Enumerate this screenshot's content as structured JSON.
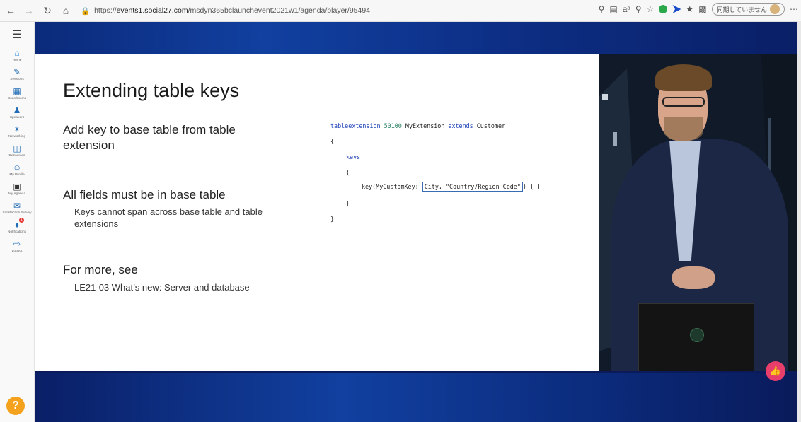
{
  "browser": {
    "url_prefix": "https://",
    "url_domain": "events1.social27.com",
    "url_path": "/msdyn365bclaunchevent2021w1/agenda/player/95494",
    "sync_label": "同期していません"
  },
  "sidebar": {
    "items": [
      {
        "label": "Home",
        "icon": "home-icon"
      },
      {
        "label": "Sessions",
        "icon": "pencil-icon"
      },
      {
        "label": "Boardrooms",
        "icon": "boardroom-icon"
      },
      {
        "label": "Speakers",
        "icon": "speaker-icon"
      },
      {
        "label": "Networking",
        "icon": "networking-icon"
      },
      {
        "label": "Resources",
        "icon": "resources-icon"
      },
      {
        "label": "My Profile",
        "icon": "profile-icon"
      },
      {
        "label": "My Agenda",
        "icon": "agenda-icon"
      },
      {
        "label": "Satisfaction Survey",
        "icon": "survey-icon"
      },
      {
        "label": "Notifications",
        "icon": "bell-icon",
        "badge": "1"
      },
      {
        "label": "Logout",
        "icon": "logout-icon"
      }
    ],
    "help": "?"
  },
  "slide": {
    "title": "Extending table keys",
    "bullet1": "Add key to base table from table extension",
    "bullet2": "All fields must be in base table",
    "sub2": "Keys cannot span across base table and table extensions",
    "bullet3": "For more, see",
    "sub3": "LE21-03 What’s new: Server and database",
    "code": {
      "l1_kw": "tableextension",
      "l1_num": "50100",
      "l1_name": "MyExtension",
      "l1_kw2": "extends",
      "l1_tbl": "Customer",
      "open": "{",
      "keys": "keys",
      "key_prefix": "key(MyCustomKey;",
      "key_fields": "City, \"Country/Region Code\"",
      "key_suffix": ") { }",
      "close": "}"
    }
  },
  "colors": {
    "accent": "#1a3fb5",
    "like": "#e83e6b",
    "help": "#f4a11d"
  }
}
